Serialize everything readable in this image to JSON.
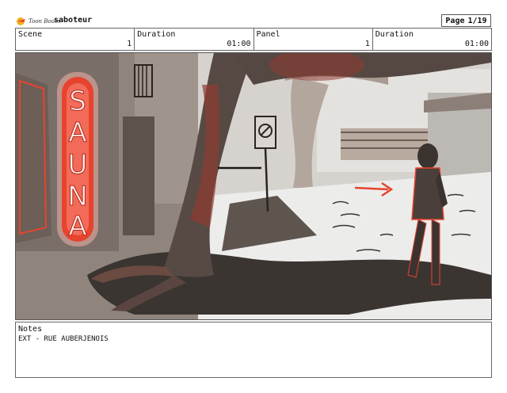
{
  "header": {
    "logo_text": "Toon Boom",
    "project_title": "saboteur",
    "page_label": "Page",
    "page_value": "1/19"
  },
  "fields": [
    {
      "label": "Scene",
      "value": "1"
    },
    {
      "label": "Duration",
      "value": "01:00"
    },
    {
      "label": "Panel",
      "value": "1"
    },
    {
      "label": "Duration",
      "value": "01:00"
    }
  ],
  "panel": {
    "sign_letters": [
      "S",
      "A",
      "U",
      "N",
      "A"
    ],
    "accent_color": "#e8432e"
  },
  "notes": {
    "label": "Notes",
    "text": "EXT - RUE AUBERJENOIS"
  }
}
